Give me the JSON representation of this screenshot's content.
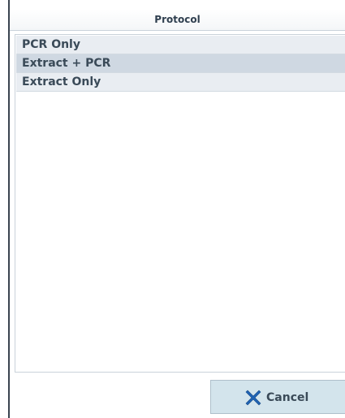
{
  "dialog": {
    "title": "Protocol"
  },
  "protocols": [
    {
      "label": "PCR Only",
      "selected": false
    },
    {
      "label": "Extract + PCR",
      "selected": true
    },
    {
      "label": "Extract Only",
      "selected": false
    }
  ],
  "footer": {
    "cancel_label": "Cancel",
    "cancel_icon": "x-icon"
  },
  "colors": {
    "accent": "#d3e4ec",
    "x_icon": "#1f63b4",
    "text": "#3a4a58"
  }
}
